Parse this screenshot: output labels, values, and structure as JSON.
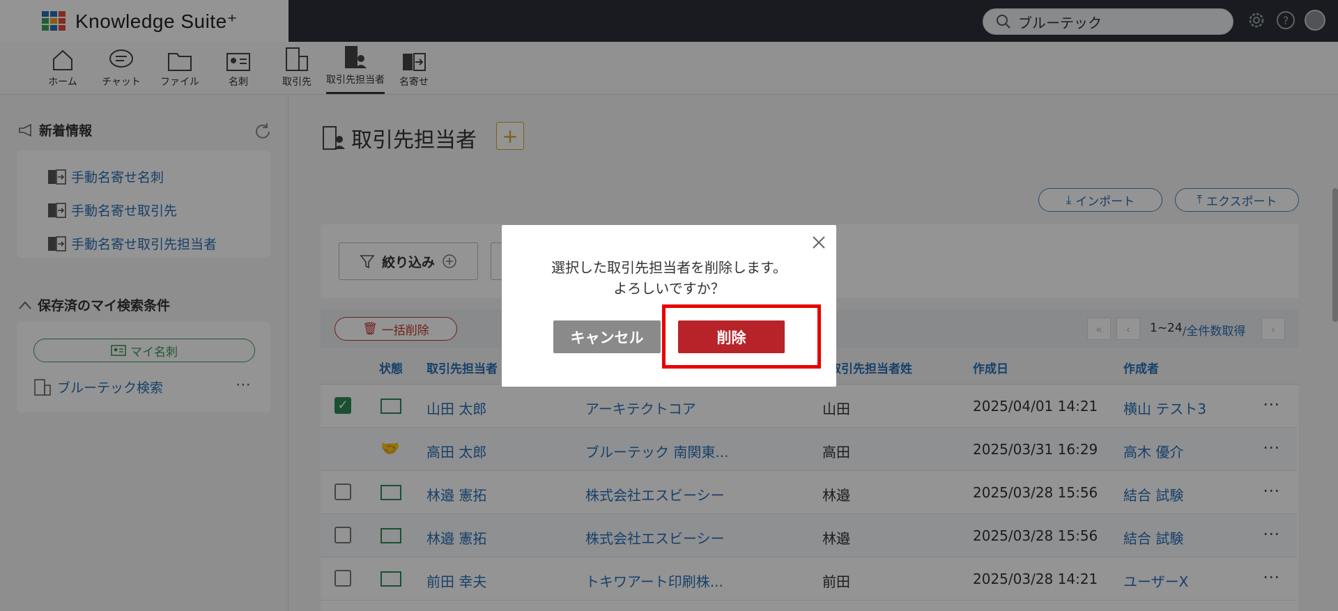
{
  "app": {
    "name": "Knowledge Suite⁺"
  },
  "search": {
    "value": "ブルーテック"
  },
  "tabs": [
    {
      "label": "ホーム",
      "icon": "home-icon"
    },
    {
      "label": "チャット",
      "icon": "chat-icon"
    },
    {
      "label": "ファイル",
      "icon": "folder-icon"
    },
    {
      "label": "名刺",
      "icon": "business-card-icon"
    },
    {
      "label": "取引先",
      "icon": "building-icon"
    },
    {
      "label": "取引先担当者",
      "icon": "contact-person-icon",
      "active": true
    },
    {
      "label": "名寄せ",
      "icon": "merge-icon"
    }
  ],
  "sidebar": {
    "news_title": "新着情報",
    "news_items": [
      "手動名寄せ名刺",
      "手動名寄せ取引先",
      "手動名寄せ取引先担当者"
    ],
    "saved_title": "保存済のマイ検索条件",
    "my_card_button": "マイ名刺",
    "saved_items": [
      "ブルーテック検索"
    ]
  },
  "main": {
    "page_title": "取引先担当者",
    "import_label": "インポート",
    "export_label": "エクスポート",
    "filter_label": "絞り込み",
    "bulk_delete_label": "一括削除",
    "pagination": {
      "range": "1~24",
      "all_label": "/全件数取得"
    }
  },
  "table": {
    "headers": {
      "status": "状態",
      "contact": "取引先担当者",
      "last_name": "取引先担当者姓",
      "created": "作成日",
      "creator": "作成者"
    },
    "rows": [
      {
        "checked": true,
        "status": "card",
        "name": "山田 太郎",
        "company": "アーキテクトコア",
        "last_name": "山田",
        "created": "2025/04/01 14:21",
        "creator": "横山 テスト3"
      },
      {
        "checked": null,
        "status": "handshake",
        "name": "高田 太郎",
        "company": "ブルーテック 南関東...",
        "last_name": "高田",
        "created": "2025/03/31 16:29",
        "creator": "高木 優介"
      },
      {
        "checked": false,
        "status": "card",
        "name": "林邉 憲拓",
        "company": "株式会社エスビーシー",
        "last_name": "林邉",
        "created": "2025/03/28 15:56",
        "creator": "結合 試験"
      },
      {
        "checked": false,
        "status": "card",
        "name": "林邉 憲拓",
        "company": "株式会社エスビーシー",
        "last_name": "林邉",
        "created": "2025/03/28 15:56",
        "creator": "結合 試験"
      },
      {
        "checked": false,
        "status": "card",
        "name": "前田 幸夫",
        "company": "トキワアート印刷株...",
        "last_name": "前田",
        "created": "2025/03/28 14:21",
        "creator": "ユーザーX"
      }
    ]
  },
  "dialog": {
    "line1": "選択した取引先担当者を削除します。",
    "line2": "よろしいですか？",
    "cancel_label": "キャンセル",
    "delete_label": "削除"
  },
  "colors": {
    "accent": "#2a6fb5",
    "danger": "#b8232a",
    "highlight": "#e80000",
    "topbar": "#2e3038"
  }
}
